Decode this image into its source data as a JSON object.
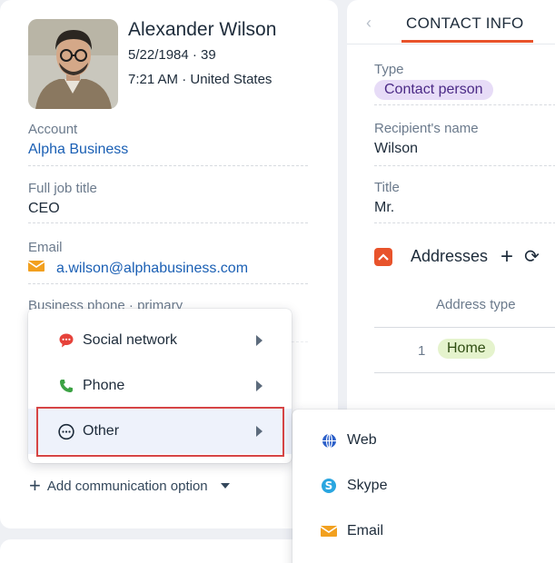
{
  "contact": {
    "name": "Alexander Wilson",
    "birth_age": "5/22/1984 · 39",
    "time_country": "7:21 AM · United States"
  },
  "fields": {
    "account_label": "Account",
    "account_value": "Alpha Business",
    "job_label": "Full job title",
    "job_value": "CEO",
    "email_label": "Email",
    "email_value": "a.wilson@alphabusiness.com",
    "phone_label": "Business phone · primary"
  },
  "menu": {
    "items": [
      {
        "label": "Social network",
        "icon": "speech-bubble-icon"
      },
      {
        "label": "Phone",
        "icon": "phone-icon"
      },
      {
        "label": "Other",
        "icon": "ellipsis-circle-icon"
      }
    ],
    "add_option_label": "Add communication option"
  },
  "submenu": {
    "items": [
      {
        "label": "Web",
        "icon": "globe-icon"
      },
      {
        "label": "Skype",
        "icon": "skype-icon"
      },
      {
        "label": "Email",
        "icon": "envelope-icon"
      }
    ]
  },
  "right": {
    "tab_label": "CONTACT INFO",
    "type_label": "Type",
    "type_value": "Contact person",
    "recipient_label": "Recipient's name",
    "recipient_value": "Wilson",
    "title_label": "Title",
    "title_value": "Mr.",
    "addresses_label": "Addresses",
    "address_type_header": "Address type",
    "row_number": "1",
    "row_type": "Home"
  },
  "colors": {
    "accent": "#e8532b",
    "link": "#1a5fb4",
    "highlight_border": "#d64545",
    "type_pill": "#e7dcf7",
    "home_pill": "#e5f3cd"
  }
}
